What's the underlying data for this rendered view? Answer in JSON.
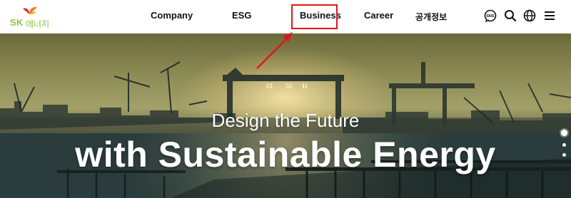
{
  "header": {
    "logo": {
      "brand": "SK",
      "name": "에너지"
    },
    "nav": [
      {
        "label": "Company"
      },
      {
        "label": "ESG"
      },
      {
        "label": "Business"
      },
      {
        "label": "Career"
      },
      {
        "label": "공개정보"
      }
    ],
    "tools": {
      "sns_label": "SNS",
      "icons": [
        "sns-icon",
        "search-icon",
        "globe-icon",
        "menu-icon"
      ]
    }
  },
  "hero": {
    "subtitle": "Design the Future",
    "title": "with Sustainable Energy",
    "slides": {
      "first": "01",
      "second": "02",
      "pause": "II"
    },
    "indicator_count": 3,
    "active_indicator": 1
  },
  "colors": {
    "brand_green": "#8cc63f",
    "highlight_red": "#e0161d",
    "nav_text": "#111111"
  }
}
